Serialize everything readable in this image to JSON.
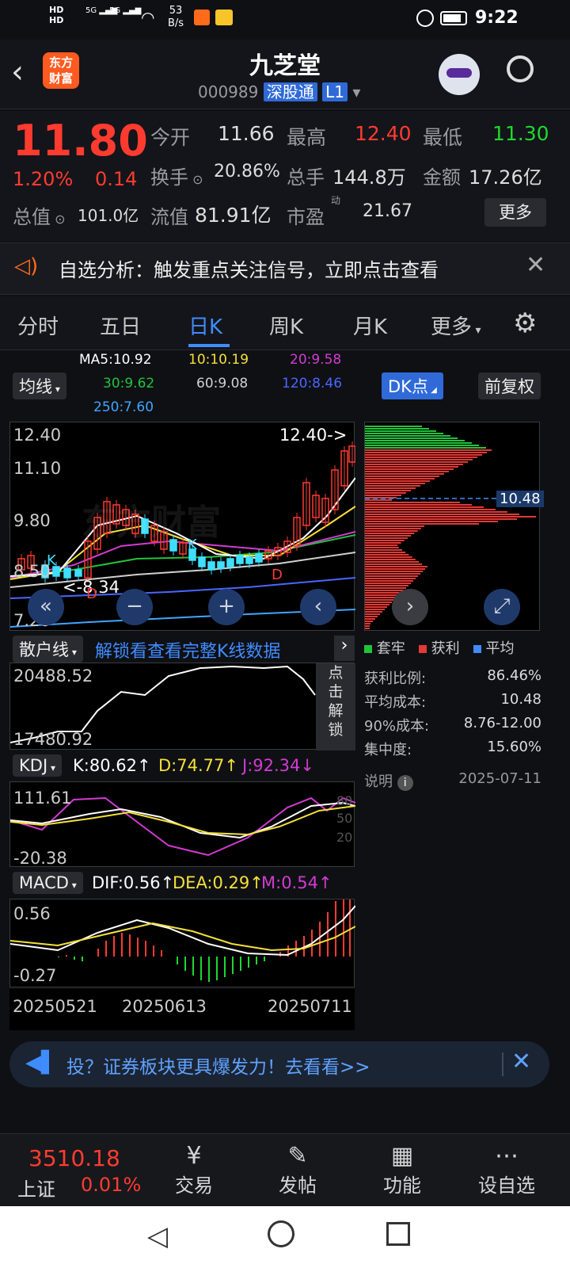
{
  "status": {
    "hd1": "HD",
    "hd2": "HD",
    "net": "5G",
    "net2": "5G",
    "speed_top": "53",
    "speed_unit": "B/s",
    "time": "9:22"
  },
  "header": {
    "logo_line1": "东方",
    "logo_line2": "财富",
    "title": "九芝堂",
    "code": "000989",
    "tag": "深股通",
    "level": "L1"
  },
  "quote": {
    "price": "11.80",
    "change_pct": "1.20%",
    "change": "0.14",
    "open_label": "今开",
    "open": "11.66",
    "high_label": "最高",
    "high": "12.40",
    "low_label": "最低",
    "low": "11.30",
    "turnover_label": "换手",
    "turnover": "20.86%",
    "volume_label": "总手",
    "volume": "144.8万",
    "amount_label": "金额",
    "amount": "17.26亿",
    "mcap_label": "总值",
    "mcap": "101.0亿",
    "float_label": "流值",
    "float": "81.91亿",
    "pe_label": "市盈",
    "pe_sup": "动",
    "pe": "21.67",
    "more": "更多"
  },
  "banner": {
    "text": "自选分析：触发重点关注信号，立即点击查看"
  },
  "tabs": [
    "分时",
    "五日",
    "日K",
    "周K",
    "月K",
    "更多"
  ],
  "ma": {
    "ma5": "MA5:10.92",
    "ma10": "10:10.19",
    "ma20": "20:9.58",
    "ma30": "30:9.62",
    "ma60": "60:9.08",
    "ma120": "120:8.46",
    "ma250": "250:7.60",
    "ma_btn": "均线",
    "dk_btn": "DK点",
    "fq_btn": "前复权",
    "c5": "#ffffff",
    "c10": "#f5e03a",
    "c20": "#d23bd2",
    "c30": "#22c33c",
    "c60": "#d0d0d0",
    "c120": "#4a66ff",
    "c250": "#3fa6ff"
  },
  "kline": {
    "y1": "12.40",
    "y2": "11.10",
    "y3": "9.80",
    "y4": "8.50",
    "y5": "7.20",
    "max_note": "12.40->",
    "min_note": "<-8.34",
    "k1": "K",
    "k2": "K",
    "d1": "D",
    "d2": "D",
    "watermark": "东方财富"
  },
  "chips": {
    "avg_label": "10.48",
    "legend_trap": "套牢",
    "legend_profit": "获利",
    "legend_avg": "平均",
    "rows": [
      {
        "k": "获利比例:",
        "v": "86.46%"
      },
      {
        "k": "平均成本:",
        "v": "10.48"
      },
      {
        "k": "90%成本:",
        "v": "8.76-12.00"
      },
      {
        "k": "集中度:",
        "v": "15.60%"
      }
    ],
    "note": "说明",
    "date": "2025-07-11"
  },
  "retail": {
    "btn": "散户线",
    "unlock": "解锁看查看完整K线数据",
    "y1": "20488.52",
    "y2": "17480.92",
    "side": "点击解锁"
  },
  "kdj": {
    "btn": "KDJ",
    "k": "K:80.62↑",
    "d": "D:74.77↑",
    "j": "J:92.34↓",
    "y1": "111.61",
    "y2": "-20.38",
    "l80": "80",
    "l50": "50",
    "l20": "20"
  },
  "macd": {
    "btn": "MACD",
    "dif": "DIF:0.56↑",
    "dea": "DEA:0.29↑",
    "m": "M:0.54↑",
    "y1": "0.56",
    "y2": "-0.27"
  },
  "dates": [
    "20250521",
    "20250613",
    "20250711"
  ],
  "ad": {
    "text": "投？证券板块更具爆发力！去看看>>"
  },
  "bottom": {
    "index_val": "3510.18",
    "index_name": "上证",
    "index_pct": "0.01%",
    "trade": "交易",
    "post": "发帖",
    "func": "功能",
    "setfav": "设自选"
  }
}
